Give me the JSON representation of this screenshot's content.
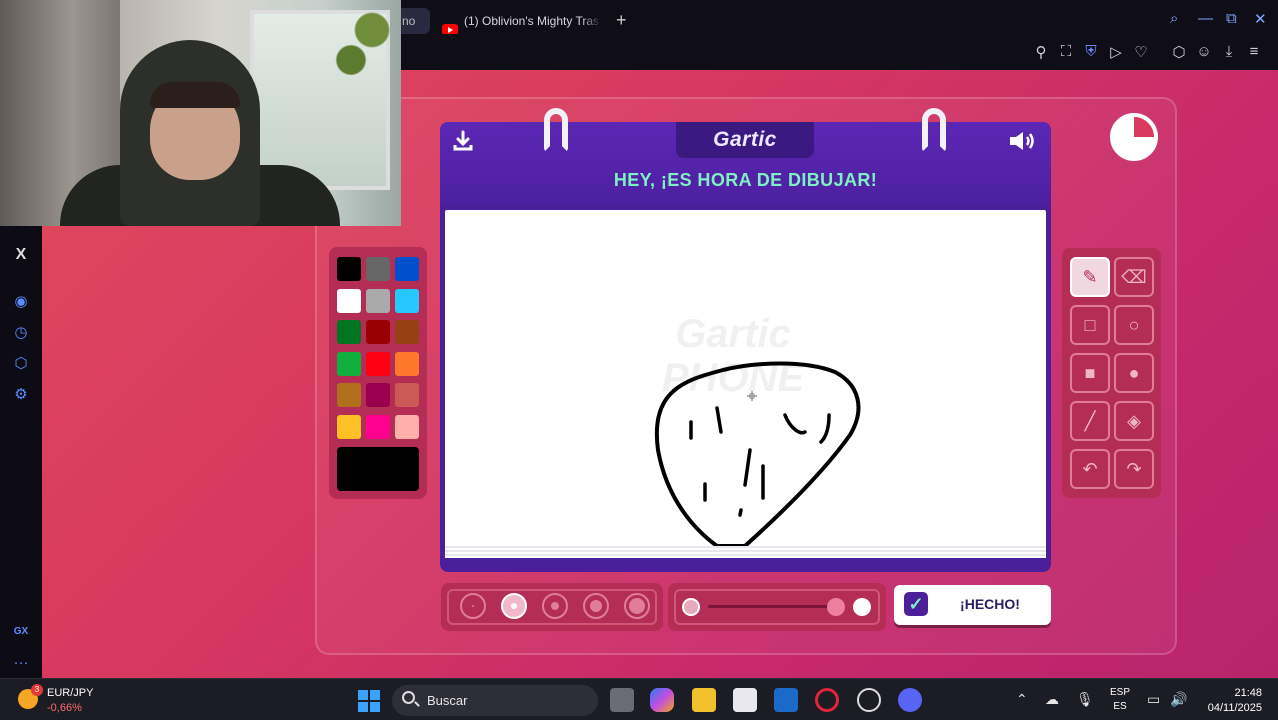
{
  "browser": {
    "tab_partial_text": "no",
    "tab_title": "(1) Oblivion's Mighty Tras",
    "new_tab": "+",
    "window_controls": {
      "search": "⌕",
      "minimize": "—",
      "restore": "⧉",
      "close": "✕"
    },
    "toolbar_icons": [
      "pin-icon",
      "screenshot-icon",
      "shield-icon",
      "play-icon",
      "heart-icon",
      "extensions-icon",
      "account-icon",
      "download-icon",
      "menu-icon"
    ]
  },
  "sidebar": {
    "items": [
      "x-icon",
      "player-icon",
      "history-icon",
      "extensions-icon",
      "settings-icon"
    ],
    "x_label": "X",
    "footer_label": "GX",
    "more_label": "···"
  },
  "game": {
    "logo": "Gartic",
    "prompt": "HEY, ¡ES HORA DE DIBUJAR!",
    "watermark_line1": "Gartic",
    "watermark_line2": "PHONE",
    "done_label": "¡HECHO!",
    "palette": [
      "#000000",
      "#666666",
      "#0050cd",
      "#ffffff",
      "#aaaaaa",
      "#26c9ff",
      "#017420",
      "#990000",
      "#964112",
      "#11b03c",
      "#ff0013",
      "#ff7829",
      "#b0701c",
      "#99004e",
      "#cb5a57",
      "#ffc126",
      "#ff008f",
      "#feafa8"
    ],
    "current_color": "#000000",
    "tools": [
      "pencil-icon",
      "eraser-icon",
      "rectangle-outline-icon",
      "circle-outline-icon",
      "rectangle-filled-icon",
      "circle-filled-icon",
      "line-icon",
      "fill-bucket-icon",
      "undo-icon",
      "redo-icon"
    ],
    "active_tool": "pencil-icon",
    "brush_sizes": 5,
    "selected_size_index": 1
  },
  "taskbar": {
    "ticker_badge": "3",
    "ticker_name": "EUR/JPY",
    "ticker_change": "-0,66%",
    "search_placeholder": "Buscar",
    "lang_top": "ESP",
    "lang_bottom": "ES",
    "time": "21:48",
    "date": "04/11/2025"
  }
}
